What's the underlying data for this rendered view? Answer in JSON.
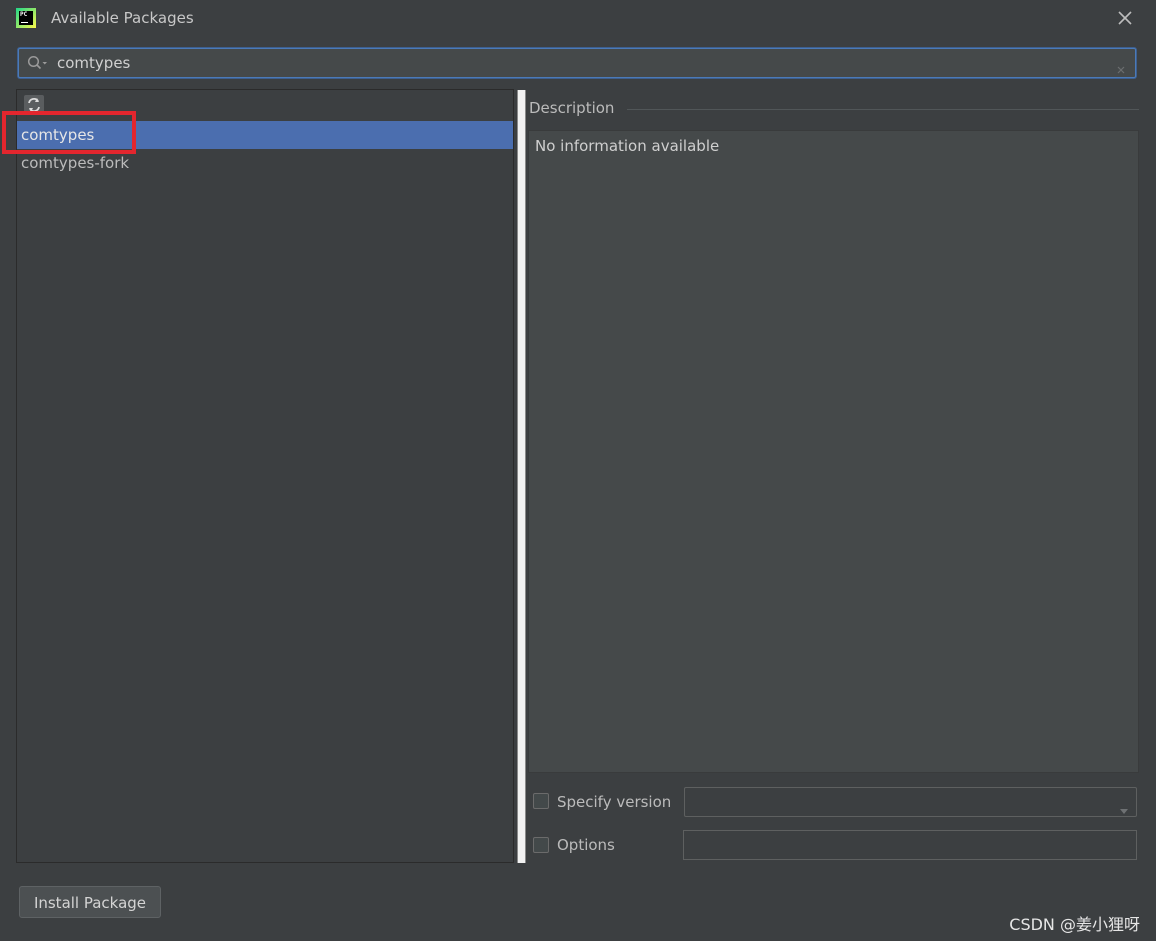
{
  "window": {
    "title": "Available Packages",
    "app_icon_text": "PC"
  },
  "search": {
    "value": "comtypes",
    "placeholder": ""
  },
  "packages": {
    "items": [
      {
        "label": "comtypes",
        "selected": true
      },
      {
        "label": "comtypes-fork",
        "selected": false
      }
    ]
  },
  "description": {
    "title": "Description",
    "text": "No information available"
  },
  "options": {
    "specify_version_label": "Specify version",
    "specify_version_checked": false,
    "version_value": "",
    "options_label": "Options",
    "options_checked": false,
    "options_value": ""
  },
  "buttons": {
    "install_label": "Install Package"
  },
  "watermark": "CSDN @姜小狸呀",
  "colors": {
    "background": "#3c3f41",
    "selection": "#4b6eaf",
    "annotation_red": "#e3262e",
    "focus_border": "#4b7ab8"
  }
}
